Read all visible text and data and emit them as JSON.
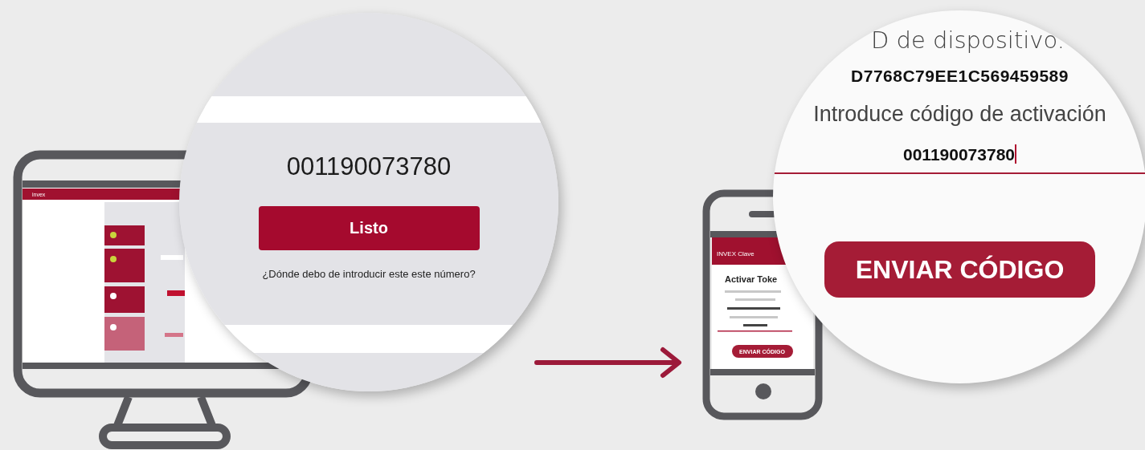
{
  "desktop": {
    "logo": "invex"
  },
  "desktop_zoom": {
    "code": "001190073780",
    "button": "Listo",
    "help_link": "¿Dónde debo de introducir este este número?"
  },
  "phone": {
    "app_title": "INVEX Clave",
    "heading": "Activar Toke",
    "button": "ENVIAR CÓDIGO"
  },
  "phone_zoom": {
    "device_id_label": "D de dispositivo.",
    "device_id": "D7768C79EE1C569459589",
    "code_label": "Introduce código de activación",
    "code_value": "001190073780",
    "button": "ENVIAR CÓDIGO"
  }
}
